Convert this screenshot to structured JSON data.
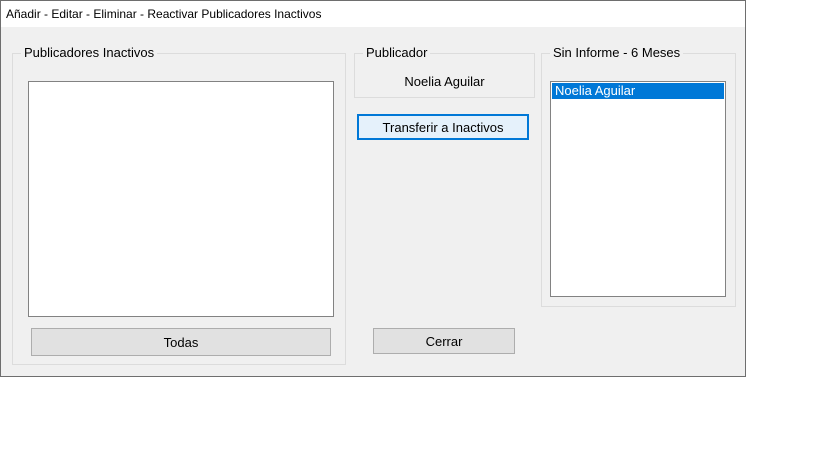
{
  "window": {
    "title": "Añadir - Editar - Eliminar - Reactivar Publicadores Inactivos"
  },
  "inactive_group": {
    "legend": "Publicadores Inactivos",
    "items": [],
    "all_button_label": "Todas"
  },
  "publisher_group": {
    "legend": "Publicador",
    "name": "Noelia Aguilar"
  },
  "transfer_button_label": "Transferir a Inactivos",
  "close_button_label": "Cerrar",
  "no_report_group": {
    "legend": "Sin Informe - 6 Meses",
    "items": [
      {
        "label": "Noelia Aguilar",
        "selected": true
      }
    ]
  },
  "colors": {
    "selection": "#0078d7",
    "window_bg": "#f0f0f0",
    "default_button_border": "#0078d7"
  }
}
